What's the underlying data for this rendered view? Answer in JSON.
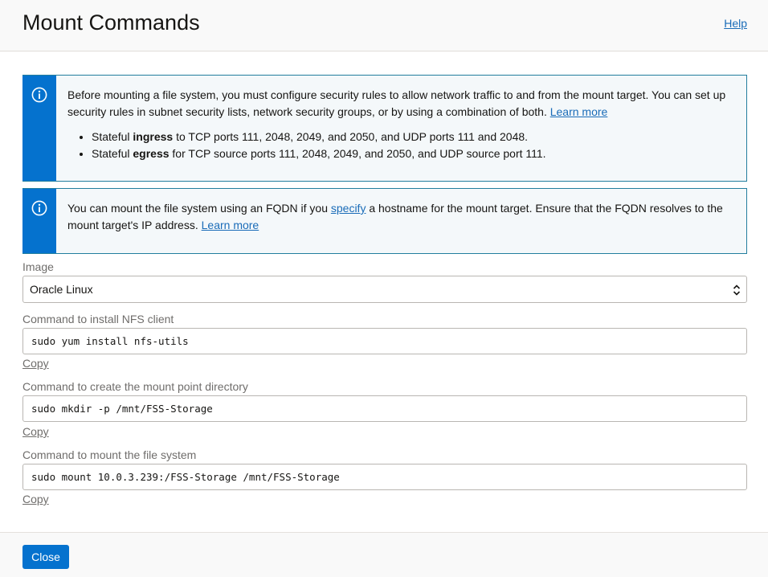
{
  "header": {
    "title": "Mount Commands",
    "help_label": "Help"
  },
  "notice1": {
    "icon": "info-icon",
    "text_before": "Before mounting a file system, you must configure security rules to allow network traffic to and from the mount target. You can set up security rules in subnet security lists, network security groups, or by using a combination of both. ",
    "learn_more": "Learn more",
    "bullets": [
      {
        "pre": "Stateful ",
        "bold": "ingress",
        "post": " to TCP ports 111, 2048, 2049, and 2050, and UDP ports 111 and 2048."
      },
      {
        "pre": "Stateful ",
        "bold": "egress",
        "post": " for TCP source ports 111, 2048, 2049, and 2050, and UDP source port 111."
      }
    ]
  },
  "notice2": {
    "icon": "info-icon",
    "text_before": "You can mount the file system using an FQDN if you ",
    "specify": "specify",
    "text_after": " a hostname for the mount target. Ensure that the FQDN resolves to the mount target's IP address. ",
    "learn_more": "Learn more"
  },
  "image_field": {
    "label": "Image",
    "value": "Oracle Linux"
  },
  "commands": [
    {
      "label": "Command to install NFS client",
      "value": "sudo yum install nfs-utils",
      "copy": "Copy"
    },
    {
      "label": "Command to create the mount point directory",
      "value": "sudo mkdir -p /mnt/FSS-Storage",
      "copy": "Copy"
    },
    {
      "label": "Command to mount the file system",
      "value": "sudo mount 10.0.3.239:/FSS-Storage /mnt/FSS-Storage",
      "copy": "Copy"
    }
  ],
  "footer": {
    "close_label": "Close"
  },
  "colors": {
    "accent": "#0572ce",
    "notice_border": "#227e9e",
    "link": "#1a6cb8"
  }
}
